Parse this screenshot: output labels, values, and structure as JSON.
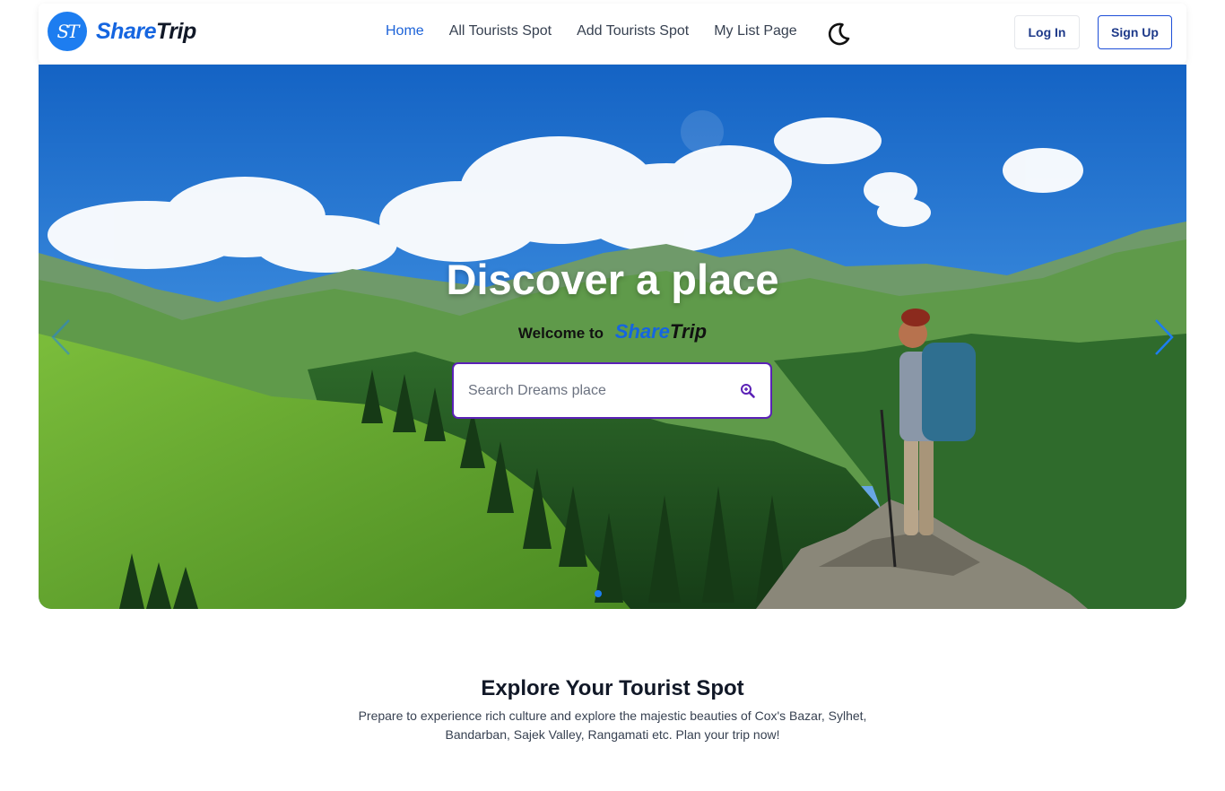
{
  "brand": {
    "logo_initials": "ST",
    "name_part1": "Share",
    "name_part2": "Trip"
  },
  "nav": {
    "items": [
      {
        "label": "Home",
        "active": true
      },
      {
        "label": "All Tourists Spot",
        "active": false
      },
      {
        "label": "Add Tourists Spot",
        "active": false
      },
      {
        "label": "My List Page",
        "active": false
      }
    ],
    "theme_icon": "moon-icon",
    "login_label": "Log In",
    "signup_label": "Sign Up"
  },
  "hero": {
    "title": "Discover a place",
    "welcome_text": "Welcome to",
    "welcome_brand_part1": "Share",
    "welcome_brand_part2": "Trip",
    "search_placeholder": "Search Dreams place",
    "search_icon": "search-magnify-icon",
    "prev_icon": "chevron-left-icon",
    "next_icon": "chevron-right-icon",
    "active_slide": 1,
    "slide_count": 1
  },
  "explore": {
    "heading": "Explore Your Tourist Spot",
    "description": "Prepare to experience rich culture and explore the majestic beauties of Cox's Bazar, Sylhet, Bandarban, Sajek Valley, Rangamati etc. Plan your trip now!"
  },
  "colors": {
    "accent": "#1d7df0",
    "nav_active": "#1d63d8",
    "search_border": "#5b21b6",
    "button_text": "#1e3a8a"
  }
}
